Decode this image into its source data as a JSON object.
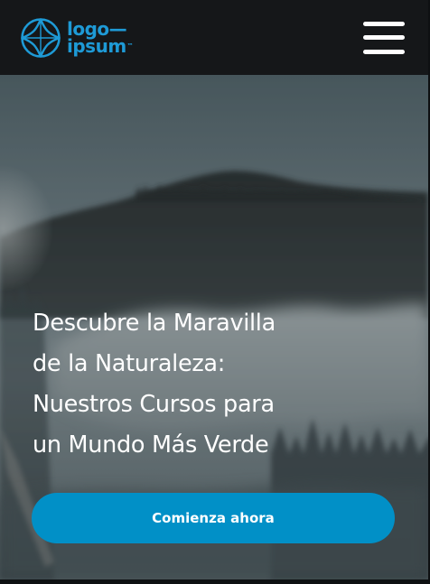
{
  "header": {
    "logo": {
      "line1": "logo",
      "line2": "ipsum",
      "trademark": "™",
      "icon": "globe-star-icon",
      "color": "#1e9ad6"
    },
    "menu": {
      "icon": "hamburger-menu-icon"
    },
    "background": "#151719"
  },
  "hero": {
    "title_lines": [
      "Descubre la Maravilla",
      "de la Naturaleza:",
      "Nuestros Cursos para",
      "un Mundo Más Verde"
    ],
    "cta_label": "Comienza ahora",
    "cta_color": "#0190c7",
    "background_image": "misty-forest-mountains-photo"
  }
}
